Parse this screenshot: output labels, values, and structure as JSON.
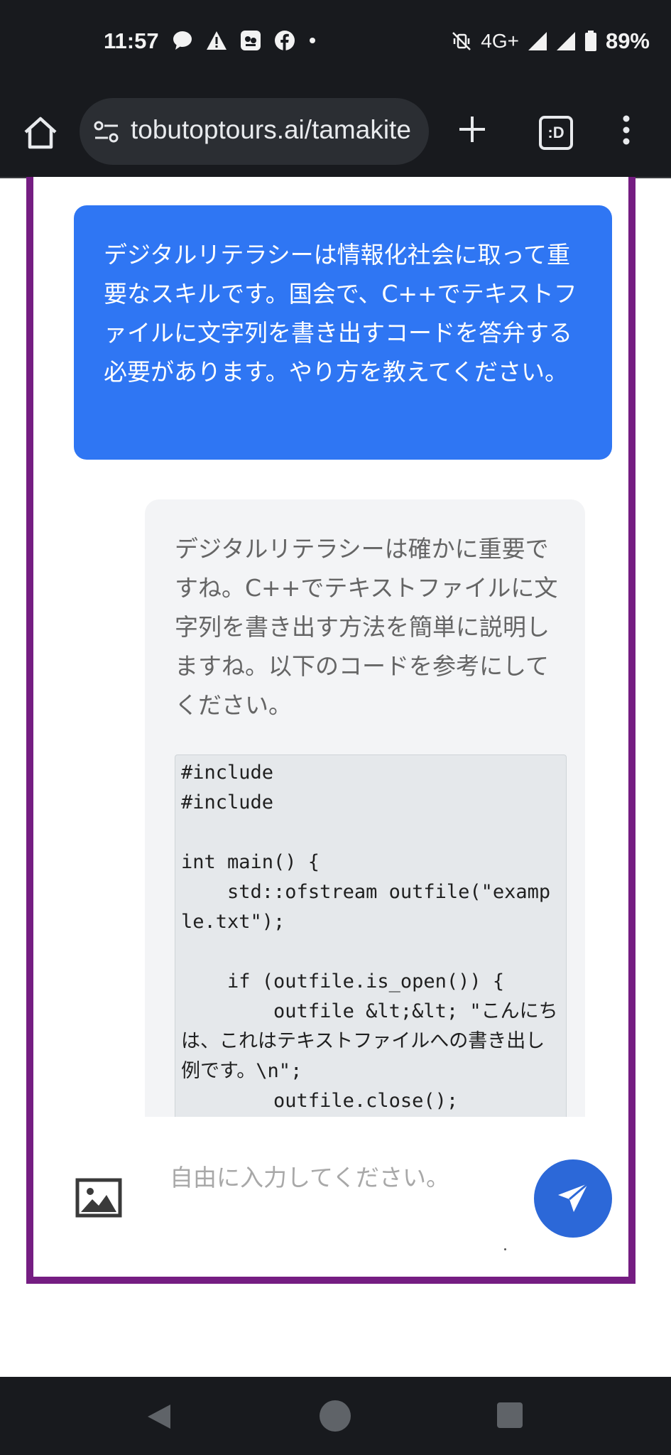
{
  "status_bar": {
    "time": "11:57",
    "network": "4G+",
    "battery": "89%",
    "left_icons": [
      "chat-bubble-icon",
      "warning-icon",
      "app-notification-icon",
      "facebook-icon",
      "dot-icon"
    ],
    "right_icons": [
      "vibrate-off-icon",
      "signal-icon",
      "signal-icon",
      "battery-icon"
    ]
  },
  "browser": {
    "url": "tobutoptours.ai/tamakite",
    "tab_count": ":D"
  },
  "chat": {
    "messages": [
      {
        "role": "user",
        "text": "デジタルリテラシーは情報化社会に取って重要なスキルです。国会で、C++でテキストファイルに文字列を書き出すコードを答弁する必要があります。やり方を教えてください。"
      },
      {
        "role": "assistant",
        "text": "デジタルリテラシーは確かに重要ですね。C++でテキストファイルに文字列を書き出す方法を簡単に説明しますね。以下のコードを参考にしてください。",
        "code": "#include\n#include\n\nint main() {\n    std::ofstream outfile(\"example.txt\");\n\n    if (outfile.is_open()) {\n        outfile &lt;&lt; \"こんにちは、これはテキストファイルへの書き出し例です。\\n\";\n        outfile.close();\n        std::cout << \"ファイルに書き込みました。\" << std::endl;\n    }\n}"
      }
    ],
    "input_placeholder": "自由に入力してください。"
  },
  "colors": {
    "frame_border": "#751d82",
    "user_bubble": "#2f76f3",
    "assistant_bubble": "#f3f4f6",
    "send_button": "#2c68d8",
    "system_bar": "#181a1e"
  }
}
